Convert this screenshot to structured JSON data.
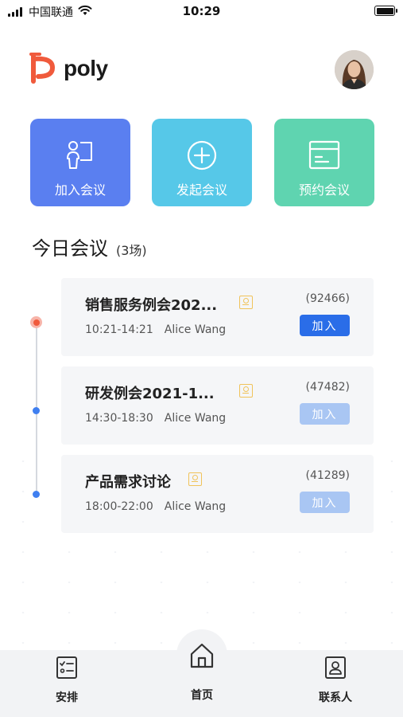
{
  "status_bar": {
    "carrier": "中国联通",
    "time": "10:29"
  },
  "header": {
    "logo_text": "poly",
    "logo_color": "#f05a3c"
  },
  "actions": [
    {
      "label": "加入会议",
      "icon": "join-person-icon",
      "color": "#5a7ff0"
    },
    {
      "label": "发起会议",
      "icon": "plus-circle-icon",
      "color": "#56c8e8"
    },
    {
      "label": "预约会议",
      "icon": "calendar-icon",
      "color": "#5fd4b0"
    }
  ],
  "today": {
    "title": "今日会议",
    "count": "(3场)"
  },
  "meetings": [
    {
      "title": "销售服务例会202...",
      "time": "10:21-14:21",
      "host": "Alice Wang",
      "code": "(92466)",
      "join_label": "加入",
      "join_enabled": true
    },
    {
      "title": "研发例会2021-1...",
      "time": "14:30-18:30",
      "host": "Alice Wang",
      "code": "(47482)",
      "join_label": "加入",
      "join_enabled": false
    },
    {
      "title": "产品需求讨论",
      "time": "18:00-22:00",
      "host": "Alice Wang",
      "code": "(41289)",
      "join_label": "加入",
      "join_enabled": false
    }
  ],
  "bottom_nav": [
    {
      "label": "安排",
      "icon": "checklist-icon"
    },
    {
      "label": "首页",
      "icon": "home-icon"
    },
    {
      "label": "联系人",
      "icon": "contact-card-icon"
    }
  ],
  "colors": {
    "primary": "#2a6de8",
    "primary_disabled": "#a9c6f3",
    "current_dot": "#f05a3c",
    "badge": "#f0c35a"
  }
}
